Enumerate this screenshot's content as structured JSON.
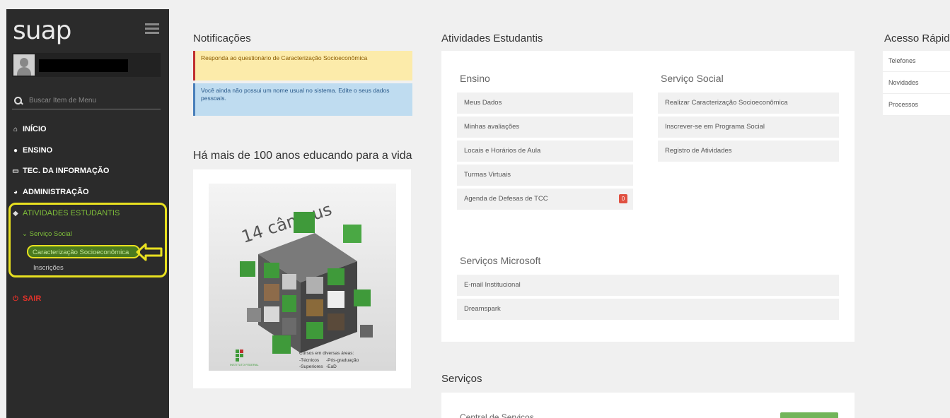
{
  "sidebar": {
    "logo": "suap",
    "search_placeholder": "Buscar Item de Menu",
    "menu": {
      "inicio": "INÍCIO",
      "ensino": "ENSINO",
      "tec": "TEC. DA INFORMAÇÃO",
      "admin": "ADMINISTRAÇÃO",
      "atividades": "ATIVIDADES ESTUDANTIS",
      "sair": "SAIR"
    },
    "submenu": {
      "servico_social": "Serviço Social",
      "caracterizacao": "Caracterização Socioeconômica",
      "inscricoes": "Inscrições"
    }
  },
  "notifications": {
    "title": "Notificações",
    "items": [
      "Responda ao questionário de Caracterização Socioeconômica",
      "Você ainda não possui um nome usual no sistema. Edite o seus dados pessoais."
    ]
  },
  "banner": {
    "title": "Há mais de 100 anos educando para a vida",
    "poster": {
      "headline": "14 câmpus",
      "courses_title": "Cursos em diversas áreas:",
      "course_1": "-Técnicos",
      "course_2": "-Pós-graduação",
      "course_3": "-Superiores",
      "course_4": "-EaD",
      "logo_text": "INSTITUTO FEDERAL"
    }
  },
  "atividades": {
    "title": "Atividades Estudantis",
    "ensino": {
      "title": "Ensino",
      "items": [
        "Meus Dados",
        "Minhas avaliações",
        "Locais e Horários de Aula",
        "Turmas Virtuais",
        "Agenda de Defesas de TCC"
      ],
      "badge": "0"
    },
    "servico_social": {
      "title": "Serviço Social",
      "items": [
        "Realizar Caracterização Socioeconômica",
        "Inscrever-se em Programa Social",
        "Registro de Atividades"
      ]
    },
    "microsoft": {
      "title": "Serviços Microsoft",
      "items": [
        "E-mail Institucional",
        "Dreamspark"
      ]
    }
  },
  "servicos": {
    "title": "Serviços",
    "partial_label": "Central de Serviços"
  },
  "acesso": {
    "title": "Acesso Rápido",
    "items": [
      "Telefones",
      "Novidades",
      "Processos"
    ]
  },
  "colors": {
    "sidebar": "#2b2b2b",
    "accent_green": "#7fbf3a",
    "danger": "#e0322a",
    "highlight": "#e8e020"
  }
}
